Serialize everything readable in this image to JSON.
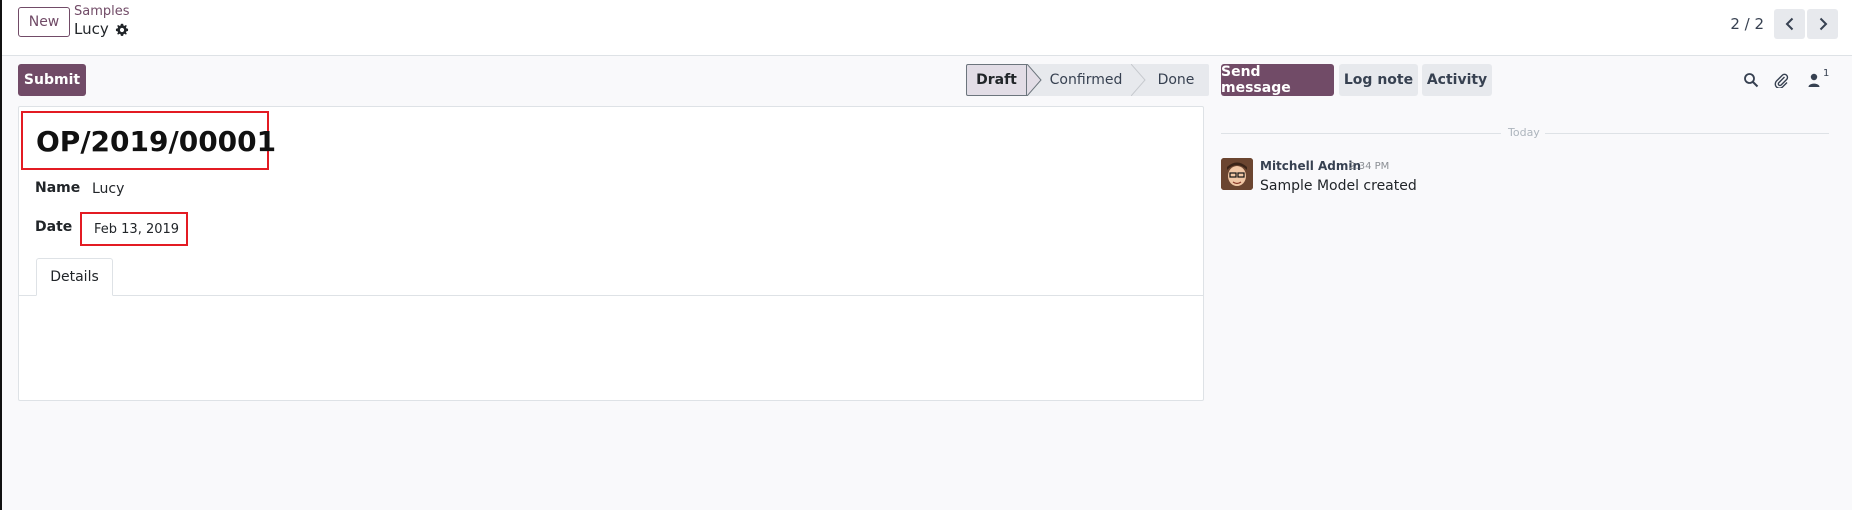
{
  "control_panel": {
    "new_button": "New",
    "breadcrumb_parent": "Samples",
    "breadcrumb_current": "Lucy",
    "pager_value": "2 / 2"
  },
  "statusbar": {
    "submit_button": "Submit",
    "stages": [
      "Draft",
      "Confirmed",
      "Done"
    ],
    "active_stage": "Draft"
  },
  "form": {
    "record_name": "OP/2019/00001",
    "fields": {
      "name_label": "Name",
      "name_value": "Lucy",
      "date_label": "Date",
      "date_value": "Feb 13, 2019"
    },
    "tabs": [
      {
        "label": "Details"
      }
    ]
  },
  "chatter": {
    "send_message": "Send message",
    "log_note": "Log note",
    "activity": "Activity",
    "follower_count": "1",
    "date_separator": "Today",
    "messages": [
      {
        "author": "Mitchell Admin",
        "time": "2:34 PM",
        "body": "Sample Model created"
      }
    ]
  },
  "icons": [
    "gear-icon",
    "chevron-left-icon",
    "chevron-right-icon",
    "search-icon",
    "paperclip-icon",
    "user-icon"
  ],
  "colors": {
    "brand": "#714b67",
    "highlight_box": "#e31b23",
    "neutral_button": "#e7e9ed"
  }
}
